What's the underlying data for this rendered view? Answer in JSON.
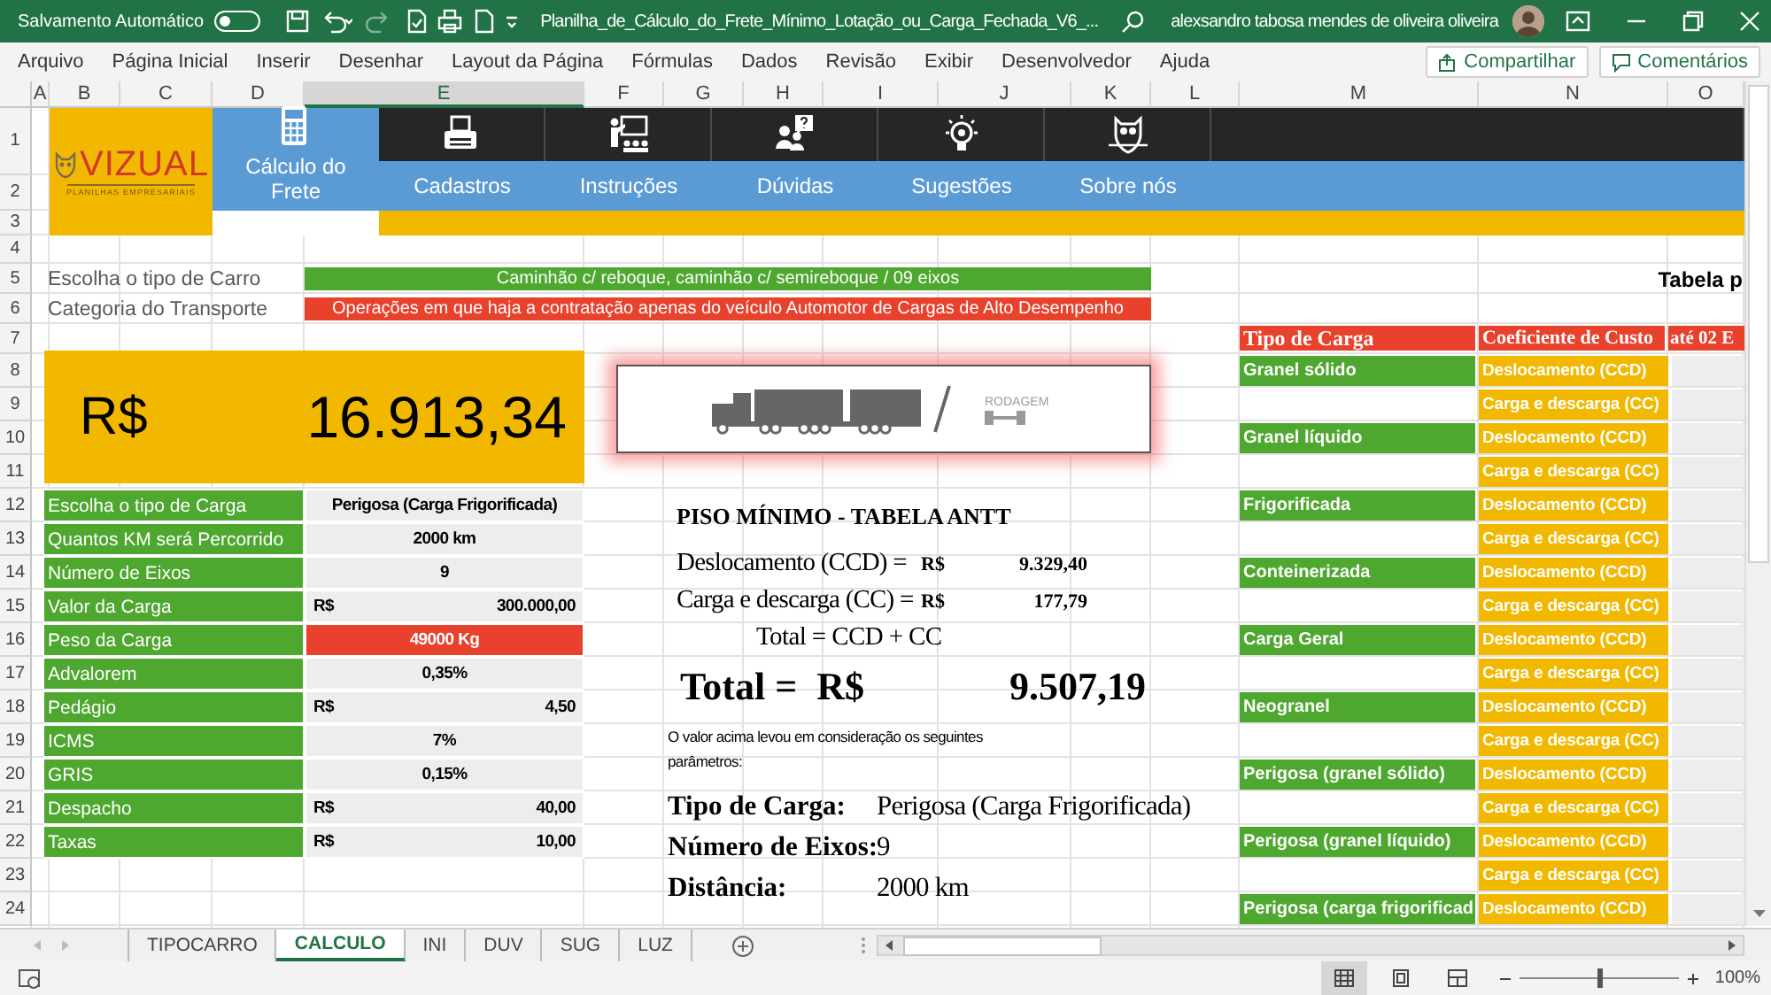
{
  "title_bar": {
    "autosave_label": "Salvamento Automático",
    "autosave_on": false,
    "file_name": "Planilha_de_Cálculo_do_Frete_Mínimo_Lotação_ou_Carga_Fechada_V6_...",
    "user_name": "alexsandro tabosa mendes de oliveira oliveira"
  },
  "menu": [
    "Arquivo",
    "Página Inicial",
    "Inserir",
    "Desenhar",
    "Layout da Página",
    "Fórmulas",
    "Dados",
    "Revisão",
    "Exibir",
    "Desenvolvedor",
    "Ajuda"
  ],
  "share_button": "Compartilhar",
  "comments_button": "Comentários",
  "columns": [
    {
      "label": "A",
      "selected": false
    },
    {
      "label": "B",
      "selected": false
    },
    {
      "label": "C",
      "selected": false
    },
    {
      "label": "D",
      "selected": false
    },
    {
      "label": "E",
      "selected": true
    },
    {
      "label": "F",
      "selected": false
    },
    {
      "label": "G",
      "selected": false
    },
    {
      "label": "H",
      "selected": false
    },
    {
      "label": "I",
      "selected": false
    },
    {
      "label": "J",
      "selected": false
    },
    {
      "label": "K",
      "selected": false
    },
    {
      "label": "L",
      "selected": false
    },
    {
      "label": "M",
      "selected": false
    },
    {
      "label": "N",
      "selected": false
    },
    {
      "label": "O",
      "selected": false
    }
  ],
  "rows": [
    "1",
    "2",
    "3",
    "4",
    "5",
    "6",
    "7",
    "8",
    "9",
    "10",
    "11",
    "12",
    "13",
    "14",
    "15",
    "16",
    "17",
    "18",
    "19",
    "20",
    "21",
    "22",
    "23",
    "24"
  ],
  "banner": {
    "logo": "VIZUAL",
    "logo_tagline": "PLANILHAS EMPRESARIAIS",
    "tiles": [
      {
        "label": "Cálculo do Frete",
        "selected": true
      },
      {
        "label": "Cadastros",
        "selected": false
      },
      {
        "label": "Instruções",
        "selected": false
      },
      {
        "label": "Dúvidas",
        "selected": false
      },
      {
        "label": "Sugestões",
        "selected": false
      },
      {
        "label": "Sobre nós",
        "selected": false
      }
    ]
  },
  "transport": [
    {
      "label": "Escolha o tipo de Carro",
      "value": "Caminhão c/ reboque, caminhão c/ semireboque / 09 eixos",
      "color": "#4ea72e"
    },
    {
      "label": "Categoria do Transporte",
      "value": "Operações em que haja a contratação apenas do veículo Automotor de Cargas de Alto Desempenho",
      "color": "#e8412c"
    }
  ],
  "table_title": "Tabela p",
  "total": {
    "currency": "R$",
    "value": "16.913,34"
  },
  "params": [
    {
      "label": "Escolha o tipo de Carga",
      "value": "Perigosa (Carga Frigorificada)",
      "kind": "text"
    },
    {
      "label": "Quantos KM será Percorrido",
      "value": "2000 km",
      "kind": "text"
    },
    {
      "label": "Número de Eixos",
      "value": "9",
      "kind": "text"
    },
    {
      "label": "Valor da Carga",
      "currency": "R$",
      "value": "300.000,00",
      "kind": "money"
    },
    {
      "label": "Peso da Carga",
      "value": "49000 Kg",
      "kind": "alert"
    },
    {
      "label": "Advalorem",
      "value": "0,35%",
      "kind": "text"
    },
    {
      "label": "Pedágio",
      "currency": "R$",
      "value": "4,50",
      "kind": "money"
    },
    {
      "label": "ICMS",
      "value": "7%",
      "kind": "text"
    },
    {
      "label": "GRIS",
      "value": "0,15%",
      "kind": "text"
    },
    {
      "label": "Despacho",
      "currency": "R$",
      "value": "40,00",
      "kind": "money"
    },
    {
      "label": "Taxas",
      "currency": "R$",
      "value": "10,00",
      "kind": "money"
    }
  ],
  "truck_banner": {
    "caption": "RODAGEM"
  },
  "antt": {
    "title": "PISO MÍNIMO - TABELA ANTT",
    "lines": [
      {
        "label": "Deslocamento (CCD) =",
        "currency": "R$",
        "value": "9.329,40"
      },
      {
        "label": "Carga e descarga (CC) =",
        "currency": "R$",
        "value": "177,79"
      }
    ],
    "formula": "Total = CCD + CC",
    "total_label": "Total =  R$",
    "total_value": "9.507,19",
    "note": "O valor acima levou em consideração os seguintes parâmetros:",
    "summary": [
      {
        "label": "Tipo de Carga:",
        "value": "Perigosa (Carga Frigorificada)"
      },
      {
        "label": "Número de Eixos:",
        "value": "9"
      },
      {
        "label": "Distância:",
        "value": "2000 km"
      }
    ]
  },
  "cost_table": {
    "columns": [
      "Tipo de Carga",
      "Coeficiente de Custo",
      "até 02 E"
    ],
    "rows": [
      {
        "type": "Granel sólido",
        "coefficient": "Deslocamento (CCD)"
      },
      {
        "coefficient": "Carga e descarga (CC)"
      },
      {
        "type": "Granel líquido",
        "coefficient": "Deslocamento (CCD)"
      },
      {
        "coefficient": "Carga e descarga (CC)"
      },
      {
        "type": "Frigorificada",
        "coefficient": "Deslocamento (CCD)"
      },
      {
        "coefficient": "Carga e descarga (CC)"
      },
      {
        "type": "Conteinerizada",
        "coefficient": "Deslocamento (CCD)"
      },
      {
        "coefficient": "Carga e descarga (CC)"
      },
      {
        "type": "Carga Geral",
        "coefficient": "Deslocamento (CCD)"
      },
      {
        "coefficient": "Carga e descarga (CC)"
      },
      {
        "type": "Neogranel",
        "coefficient": "Deslocamento (CCD)"
      },
      {
        "coefficient": "Carga e descarga (CC)"
      },
      {
        "type": "Perigosa (granel sólido)",
        "coefficient": "Deslocamento (CCD)"
      },
      {
        "coefficient": "Carga e descarga (CC)"
      },
      {
        "type": "Perigosa (granel líquido)",
        "coefficient": "Deslocamento (CCD)"
      },
      {
        "coefficient": "Carga e descarga (CC)"
      },
      {
        "type": "Perigosa (carga frigorificad",
        "coefficient": "Deslocamento (CCD)"
      }
    ]
  },
  "sheet_tabs": [
    {
      "label": "TIPOCARRO",
      "selected": false
    },
    {
      "label": "CALCULO",
      "selected": true
    },
    {
      "label": "INI",
      "selected": false
    },
    {
      "label": "DUV",
      "selected": false
    },
    {
      "label": "SUG",
      "selected": false
    },
    {
      "label": "LUZ",
      "selected": false
    }
  ],
  "status": {
    "views": [
      {
        "selected": true
      },
      {
        "selected": false
      },
      {
        "selected": false
      }
    ],
    "level": 0.5,
    "zoom": "100%"
  }
}
